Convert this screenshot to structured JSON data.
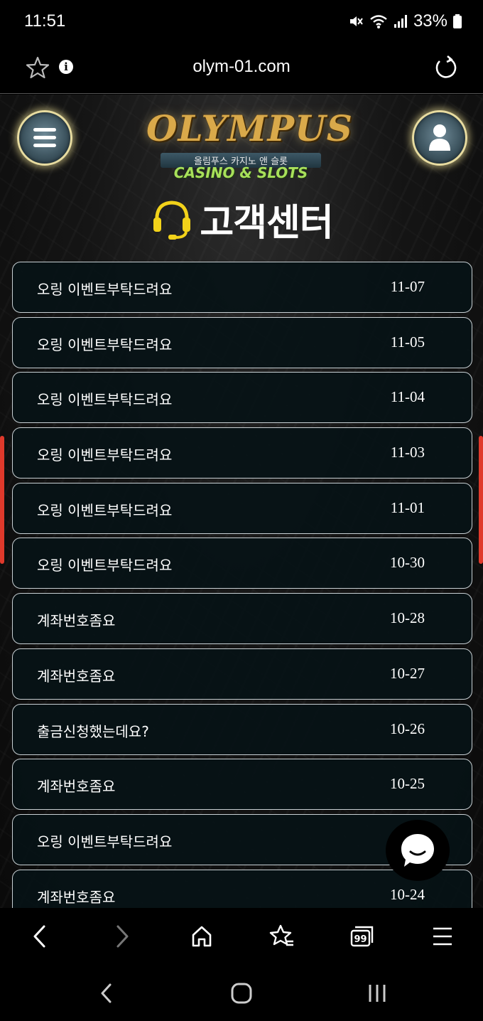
{
  "status_bar": {
    "time": "11:51",
    "battery": "33%"
  },
  "browser": {
    "url": "olym-01.com",
    "info_glyph": "i"
  },
  "logo": {
    "title": "OLYMPUS",
    "subtitle": "올림푸스 카지노 앤 슬롯",
    "tagline": "CASINO & SLOTS"
  },
  "page": {
    "heading": "고객센터"
  },
  "posts": [
    {
      "title": "오링 이벤트부탁드려요",
      "date": "11-07"
    },
    {
      "title": "오링 이벤트부탁드려요",
      "date": "11-05"
    },
    {
      "title": "오링 이벤트부탁드려요",
      "date": "11-04"
    },
    {
      "title": "오링 이벤트부탁드려요",
      "date": "11-03"
    },
    {
      "title": "오링 이벤트부탁드려요",
      "date": "11-01"
    },
    {
      "title": "오링 이벤트부탁드려요",
      "date": "10-30"
    },
    {
      "title": "계좌번호좀요",
      "date": "10-28"
    },
    {
      "title": "계좌번호좀요",
      "date": "10-27"
    },
    {
      "title": "출금신청했는데요?",
      "date": "10-26"
    },
    {
      "title": "계좌번호좀요",
      "date": "10-25"
    },
    {
      "title": "오링 이벤트부탁드려요",
      "date": ""
    },
    {
      "title": "계좌번호좀요",
      "date": "10-24"
    }
  ],
  "toolbar": {
    "tabs_count": "99"
  },
  "colors": {
    "accent": "#e0392b",
    "row_bg": "#06161a",
    "row_border": "#c8d0d4",
    "headset": "#f2d21a"
  }
}
